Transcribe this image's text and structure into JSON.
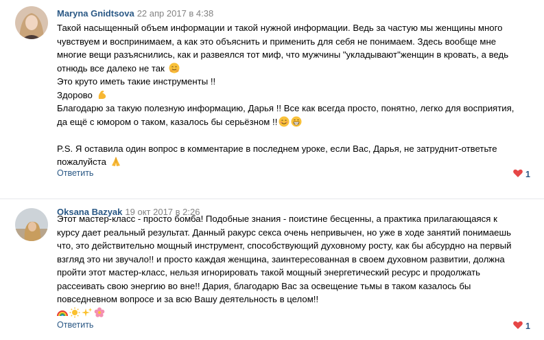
{
  "comments": [
    {
      "author": "Maryna Gnidtsova",
      "date": "22 апр 2017 в 4:38",
      "lines": [
        "Такой насыщенный объем информации и такой нужной информации. Ведь за частую мы женщины много",
        "чувствуем и воспринимаем, а как это объяснить и применить для себя не понимаем. Здесь вообще мне",
        "многие вещи разъяснились, как и развеялся тот миф, что мужчины \"укладывают\"женщин в кровать, а ведь",
        "отнюдь все далеко не так",
        "Это круто иметь такие инструменты !!",
        "Здорово",
        "Благодарю за такую полезную информацию, Дарья !! Все как всегда просто, понятно, легко для восприятия,",
        "да ещё с юмором о таком, казалось бы серьёзном !!",
        "",
        "P.S. Я оставила один вопрос в комментарие в последнем уроке, если Вас, Дарья, не затруднит-ответьте",
        "пожалуйста"
      ],
      "reply_label": "Ответить",
      "likes": "1"
    },
    {
      "author": "Oksana Bazyak",
      "date": "19 окт 2017 в 2:26",
      "lines": [
        "Этот мастер-класс - просто бомба! Подобные знания - поистине бесценны, а практика прилагающаяся к",
        "курсу дает реальный результат. Данный ракурс секса очень непривычен, но уже в ходе занятий понимаешь",
        "что, это действительно мощный инструмент, способствующий духовному росту, как бы абсурдно на первый",
        "взгляд это ни звучало!! и просто каждая женщина, заинтересованная в своем духовном развитии, должна",
        "пройти этот мастер-класс, нельзя игнорировать такой мощный энергетический ресурс и продолжать",
        "рассеивать свою энергию во вне!! Дария, благодарю Вас за освещение тьмы в таком казалось бы",
        "повседневном вопросе и за всю Вашу деятельность в целом!!",
        ""
      ],
      "reply_label": "Ответить",
      "likes": "1"
    }
  ],
  "colors": {
    "link": "#2a5885",
    "date": "#828282",
    "heart": "#e64646"
  }
}
